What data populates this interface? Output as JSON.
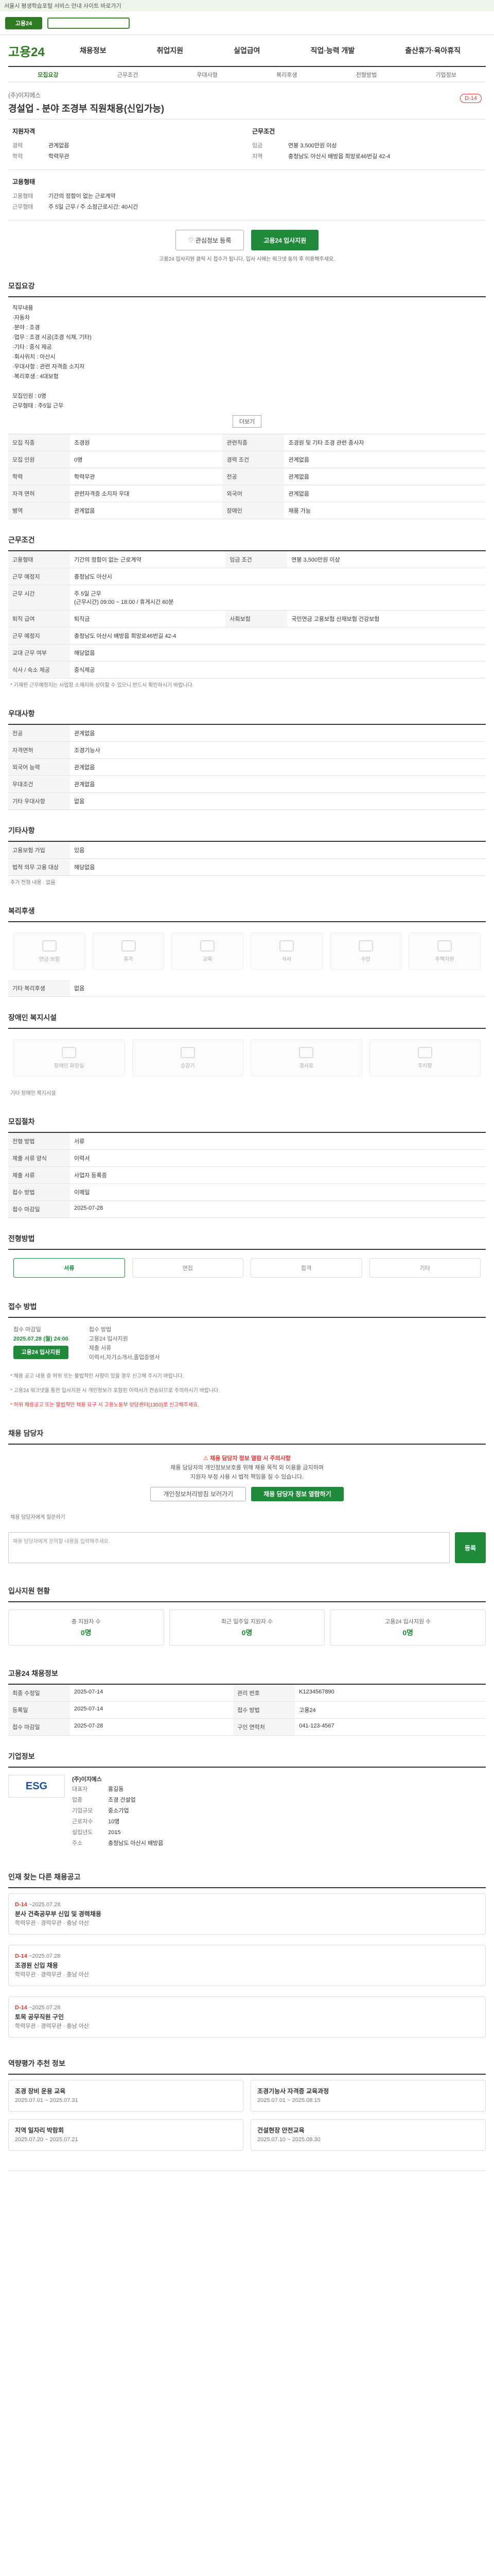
{
  "notice": "서울시 평생학습포털 서비스 안내 사이트 바로가기",
  "logo": "고용24",
  "brand": "고용24",
  "nav": [
    "채용정보",
    "취업지원",
    "실업급여",
    "직업·능력 개발",
    "출산휴가·육아휴직"
  ],
  "tabs": [
    "모집요강",
    "근무조건",
    "우대사항",
    "복리후생",
    "전형방법",
    "기업정보"
  ],
  "job": {
    "company": "(주)이지에스",
    "title": "경설업 - 분야 조경부 직원채용(신입가능)",
    "dday": "D-14"
  },
  "req_block": {
    "heading": "지원자격",
    "rows": [
      [
        "경력",
        "관계없음"
      ],
      [
        "학력",
        "학력무관"
      ]
    ]
  },
  "cond_block": {
    "heading": "근무조건",
    "rows": [
      [
        "임금",
        "연봉 3,500만원 이상"
      ],
      [
        "지역",
        "충청남도 아산시 배방읍 희망로46번길 42-4"
      ]
    ]
  },
  "cond_block2": {
    "heading": "고용형태",
    "rows": [
      [
        "고용형태",
        "기간의 정함이 없는 근로계약"
      ],
      [
        "근무형태",
        "주 5일 근무 / 주 소정근로시간: 40시간"
      ]
    ]
  },
  "act": {
    "save": "관심정보 등록",
    "apply": "고용24 입사지원",
    "note": "고용24 입사지원 클릭 시 접수가 됩니다. 입사 시에는 워크넷 동의 후 이용해주세요."
  },
  "sec1": {
    "title": "모집요강",
    "body": "직무내용\n·자동차 \n·분야 : 조경 \n·업무 : 조경 시공(조경 식재, 기타) \n·기타 : 중식 제공\n·회사위치 : 아산시 \n·우대사항 : 관련 자격증 소지자\n·복리후생 : 4대보험\n\n모집인원 : 0명\n근무형태 : 주5일 근무",
    "more": "더보기"
  },
  "grid1": [
    [
      "모집 직종",
      "조경원",
      "관련직종",
      "조경원 및 기타 조경 관련 종사자"
    ],
    [
      "모집 인원",
      "0명",
      "경력 조건",
      "관계없음"
    ],
    [
      "학력",
      "학력무관",
      "전공",
      "관계없음"
    ],
    [
      "자격 면허",
      "관련자격증 소지자 우대",
      "외국어",
      "관계없음"
    ],
    [
      "병역",
      "관계없음",
      "장애인",
      "채용 가능"
    ]
  ],
  "sec2": {
    "title": "근무조건",
    "rows": [
      [
        "고용형태",
        "기간의 정함이 없는 근로계약",
        "임금 조건",
        "연봉 3,500만원 이상"
      ],
      [
        "근무 예정지",
        "충청남도 아산시",
        "",
        ""
      ],
      [
        "근무 시간",
        "주 5일 근무\n(근무시간) 09:00 ~ 18:00 / 휴게시간 60분",
        "",
        ""
      ],
      [
        "퇴직 급여",
        "퇴직금",
        "사회보험",
        "국민연금 고용보험 산재보험 건강보험"
      ],
      [
        "근무 예정지",
        "충청남도 아산시 배방읍 희망로46번길 42-4",
        "",
        ""
      ],
      [
        "교대 근무 여부",
        "해당없음",
        "",
        ""
      ],
      [
        "식사 / 숙소 제공",
        "중식제공",
        "",
        ""
      ]
    ],
    "map": "지도보기",
    "fine": "* 기재된 근무예정지는 사업장 소재지와 상이할 수 있으니 반드시 확인하시기 바랍니다."
  },
  "sec3": {
    "title": "우대사항",
    "rows": [
      [
        "전공",
        "관계없음"
      ],
      [
        "자격면허",
        "조경기능사"
      ],
      [
        "외국어 능력",
        "관계없음"
      ],
      [
        "우대조건",
        "관계없음"
      ],
      [
        "기타 우대사항",
        "없음"
      ]
    ]
  },
  "sec4": {
    "title": "기타사항",
    "rows": [
      [
        "고용보험 가입",
        "있음"
      ],
      [
        "법적 의무 고용 대상",
        "해당없음"
      ]
    ]
  },
  "sec4b": {
    "label": "추가 전형 내용",
    "value": "없음"
  },
  "sec5": {
    "title": "복리후생",
    "items": [
      "연금·보험",
      "휴가",
      "교육",
      "식사",
      "수당",
      "주택지원"
    ],
    "fine": "기타 복리후생",
    "etc": "없음"
  },
  "sec6": {
    "title": "장애인 복지시설",
    "items": [
      "장애인 화장실",
      "승강기",
      "경사로",
      "주차장"
    ],
    "fine": "기타 장애인 복지시설"
  },
  "sec7": {
    "title": "모집절차",
    "rows": [
      [
        "전형 방법",
        "서류"
      ],
      [
        "제출 서류 양식",
        "이력서"
      ],
      [
        "제출 서류",
        "사업자 등록증"
      ],
      [
        "접수 방법",
        "이메일"
      ],
      [
        "접수 마감일",
        "2025-07-28"
      ]
    ]
  },
  "sec8": {
    "title": "전형방법",
    "steps": [
      "서류",
      "면접",
      "합격",
      "기타"
    ]
  },
  "sec9": {
    "title": "접수 방법",
    "l1": "접수 마감일",
    "l1v": "2025.07.28 (월) 24:00",
    "l2": "접수 방법",
    "l2v": "고용24 입사지원",
    "apply": "고용24 입사지원",
    "l3": "제출 서류",
    "l3v": "이력서,자기소개서,졸업증명서"
  },
  "fine9": [
    "* 채용 공고 내용 중 허위 또는 불법적인 사항이 있을 경우 신고해 주시기 바랍니다.",
    "* 고용24 워크넷을 통한 입사지원 시 개인정보가 포함된 이력서가 전송되므로 주의하시기 바랍니다."
  ],
  "fine9red": "* 허위 채용공고 또는 불법적인 채용 요구 시 고용노동부 상담센터(1350)로 신고해주세요.",
  "sec10": {
    "title": "채용 담당자",
    "hl": "채용 담당자 정보 열람 시 주의사항",
    "t1": "채용 담당자의 개인정보보호를 위해 채용 목적 외 이용을 금지하며",
    "t2": "지원자 부정 사용 시 법적 책임을 질 수 있습니다.",
    "b1": "개인정보처리방침 보러가기",
    "b2": "채용 담당자 정보 열람하기"
  },
  "inquiry": {
    "label": "채용 담당자에게 질문하기",
    "ph": "채용 담당자에게 문의할 내용을 입력해주세요.",
    "btn": "등록"
  },
  "sec11": {
    "title": "입사지원 현황",
    "cards": [
      [
        "총 지원자 수",
        "0명"
      ],
      [
        "최근 일주일 지원자 수",
        "0명"
      ],
      [
        "고용24 입사지원 수",
        "0명"
      ]
    ]
  },
  "sec12": {
    "title": "고용24 채용정보",
    "rows": [
      [
        "최종 수정일",
        "2025-07-14",
        "관리 번호",
        "K1234567890"
      ],
      [
        "등록일",
        "2025-07-14",
        "접수 방법",
        "고용24"
      ],
      [
        "접수 마감일",
        "2025-07-28",
        "구인 연락처",
        "041-123-4567"
      ]
    ]
  },
  "sec13": {
    "title": "기업정보",
    "logo": "ESG",
    "name": "(주)이지에스",
    "rows": [
      [
        "대표자",
        "홍길동"
      ],
      [
        "업종",
        "조경 건설업"
      ],
      [
        "기업규모",
        "중소기업"
      ],
      [
        "근로자수",
        "10명"
      ],
      [
        "설립년도",
        "2015"
      ],
      [
        "주소",
        "충청남도 아산시 배방읍"
      ]
    ]
  },
  "sec14": {
    "title": "인재 찾는 다른 채용공고",
    "cards": [
      {
        "dday": "D-14",
        "date": "~2025.07.28",
        "title": "분사 건축공무부 신입 및 경력채용",
        "sub": "학력무관 · 경력무관 · 충남 아산"
      },
      {
        "dday": "D-14",
        "date": "~2025.07.28",
        "title": "조경원 신입 채용",
        "sub": "학력무관 · 경력무관 · 충남 아산"
      },
      {
        "dday": "D-14",
        "date": "~2025.07.28",
        "title": "토목 공무직원 구인",
        "sub": "학력무관 · 경력무관 · 충남 아산"
      }
    ]
  },
  "sec15": {
    "title": "역량평가 추천 정보",
    "items": [
      [
        "조경 장비 운용 교육",
        "2025.07.01 ~ 2025.07.31"
      ],
      [
        "조경기능사 자격증 교육과정",
        "2025.07.01 ~ 2025.08.15"
      ],
      [
        "지역 일자리 박람회",
        "2025.07.20 ~ 2025.07.21"
      ],
      [
        "건설현장 안전교육",
        "2025.07.10 ~ 2025.08.30"
      ]
    ]
  }
}
